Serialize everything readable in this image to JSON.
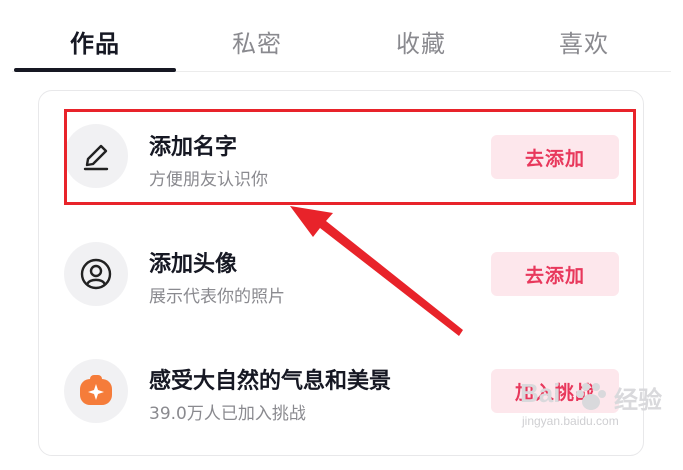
{
  "tabs": [
    {
      "label": "作品",
      "active": true
    },
    {
      "label": "私密",
      "active": false
    },
    {
      "label": "收藏",
      "active": false
    },
    {
      "label": "喜欢",
      "active": false
    }
  ],
  "tasks": [
    {
      "icon": "pencil-icon",
      "title": "添加名字",
      "subtitle": "方便朋友认识你",
      "button": "去添加"
    },
    {
      "icon": "user-avatar-icon",
      "title": "添加头像",
      "subtitle": "展示代表你的照片",
      "button": "去添加"
    },
    {
      "icon": "sparkle-challenge-icon",
      "title": "感受大自然的气息和美景",
      "subtitle": "39.0万人已加入挑战",
      "button": "加入挑战"
    }
  ],
  "watermark": {
    "brand": "Bai",
    "brand_cn": "经验",
    "url": "jingyan.baidu.com"
  },
  "colors": {
    "accent": "#e8385c",
    "button_bg": "#fde7ec",
    "highlight": "#e8232a",
    "challenge_icon": "#f57c3a"
  }
}
